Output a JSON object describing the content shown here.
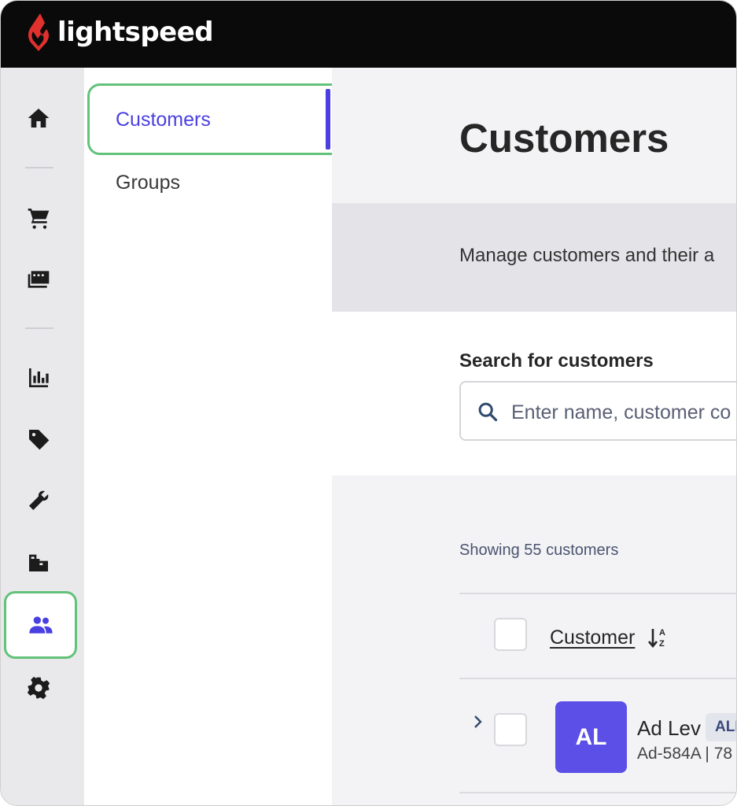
{
  "brand": {
    "name": "lightspeed",
    "mark_color": "#e0312f",
    "accent": "#4a3fe0",
    "highlight": "#63c27a"
  },
  "rail": {
    "items": [
      {
        "icon": "home-icon"
      },
      {
        "icon": "cart-icon"
      },
      {
        "icon": "register-icon"
      },
      {
        "icon": "reports-icon"
      },
      {
        "icon": "tag-icon"
      },
      {
        "icon": "wrench-icon"
      },
      {
        "icon": "inventory-icon"
      },
      {
        "icon": "customers-icon",
        "active": true
      },
      {
        "icon": "gear-icon"
      }
    ]
  },
  "subnav": {
    "items": [
      {
        "label": "Customers",
        "active": true
      },
      {
        "label": "Groups"
      }
    ]
  },
  "main": {
    "title": "Customers",
    "description": "Manage customers and their a",
    "search": {
      "label": "Search for customers",
      "placeholder": "Enter name, customer co"
    },
    "showing": "Showing 55 customers",
    "table": {
      "column_header": "Customer",
      "rows": [
        {
          "initials": "AL",
          "name": "Ad Lev",
          "badge": "ALI",
          "sub": "Ad-584A | 78"
        }
      ]
    }
  }
}
